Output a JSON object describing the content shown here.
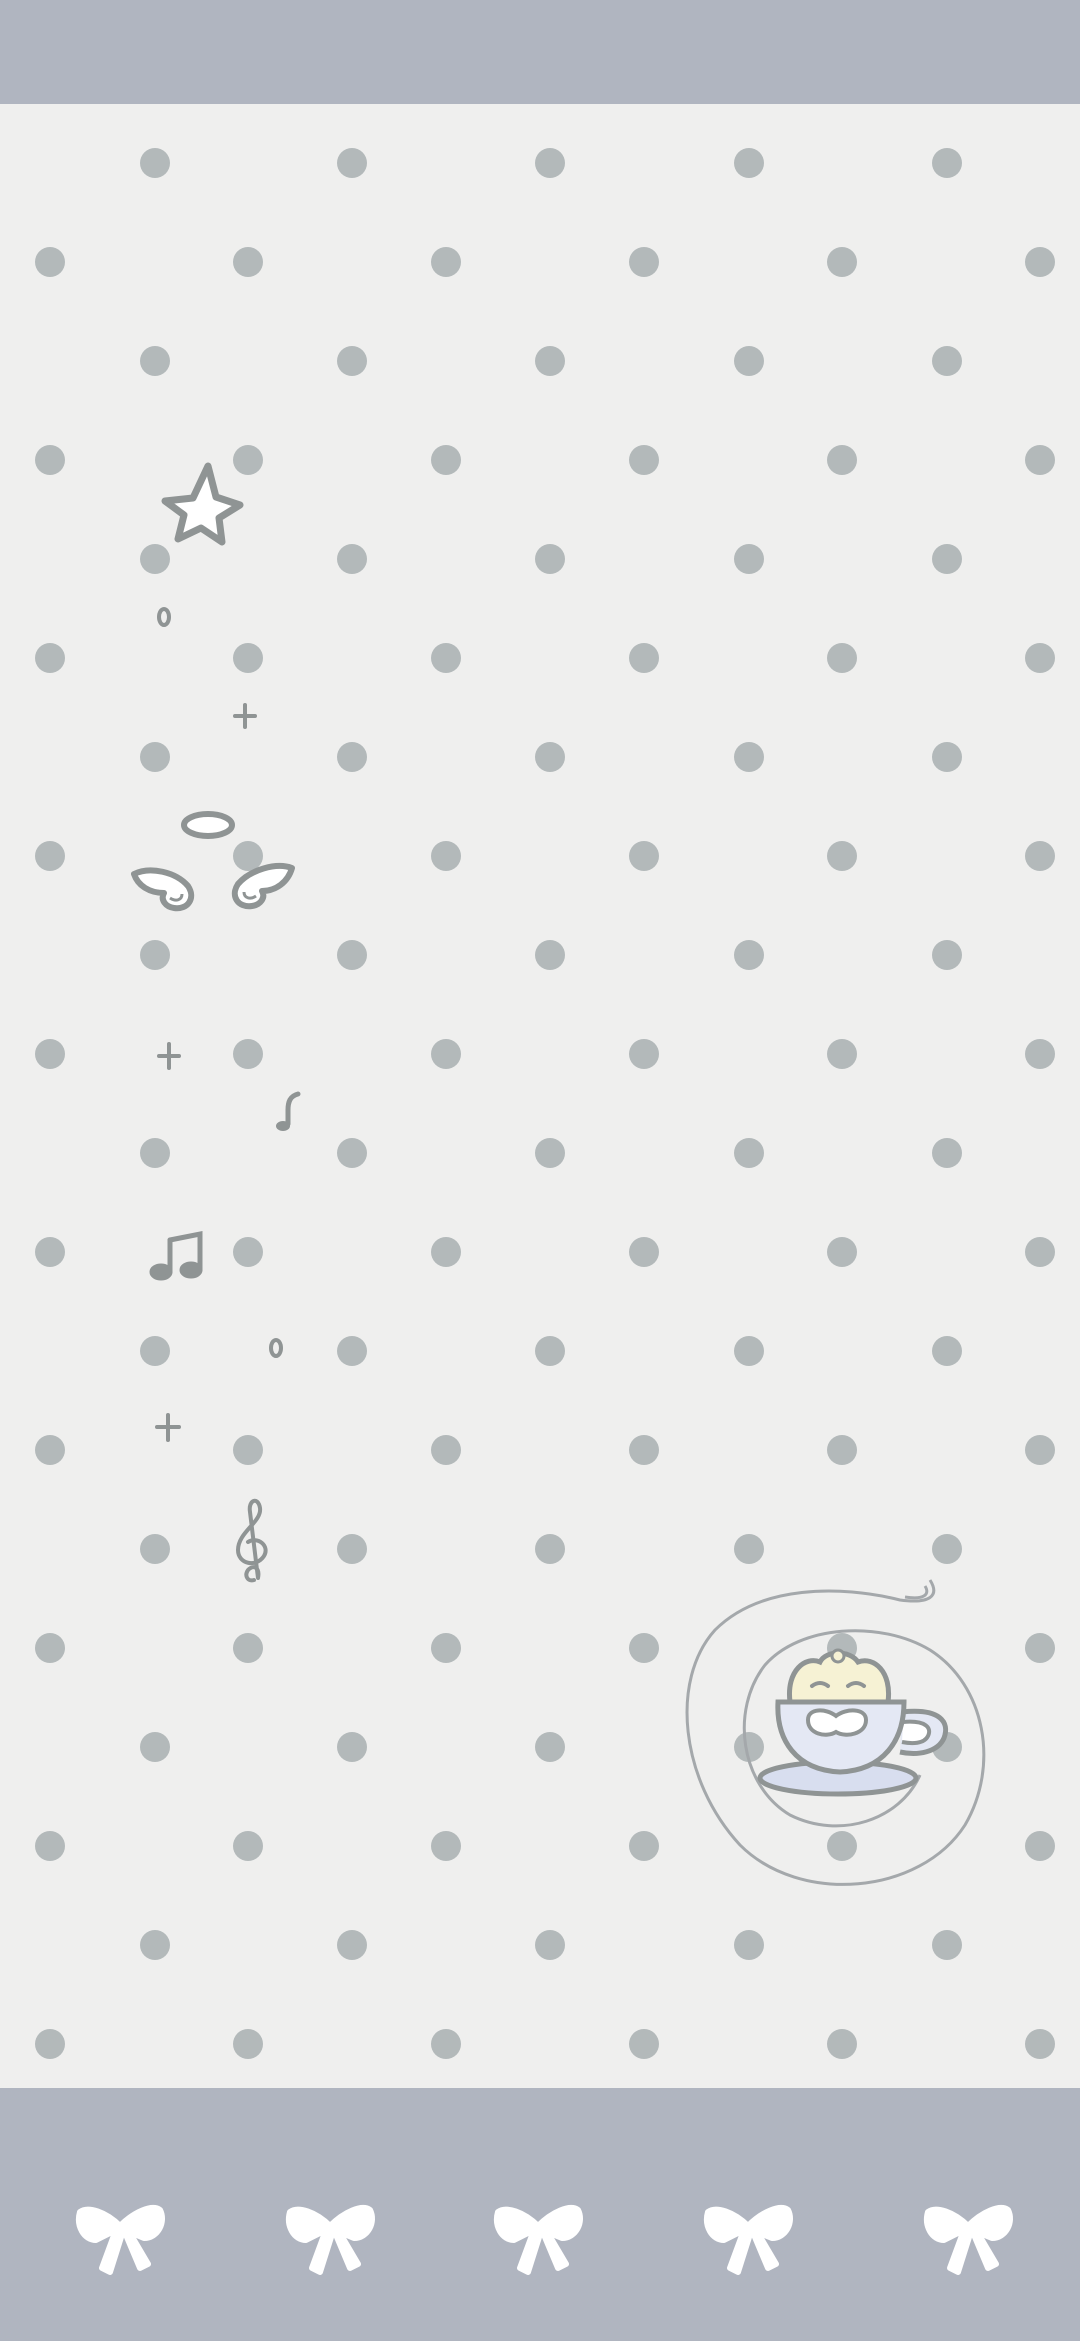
{
  "wallpaper": {
    "colors": {
      "band": "#b0b5c0",
      "paper": "#efefee",
      "dot": "#b3b9ba",
      "doodle_stroke": "#8f9494",
      "star_fill": "#ffffff",
      "cup_fill": "#e4e8f4",
      "cup_saucer_fill": "#d8deef",
      "creature_fill": "#f6f2d4",
      "bow_fill": "#ffffff",
      "swirl_stroke": "#a4a8ab"
    },
    "icons": [
      "star-icon",
      "halo-icon",
      "wing-left-icon",
      "wing-right-icon",
      "sparkle-icon",
      "eighth-note-icon",
      "beamed-notes-icon",
      "treble-clef-icon",
      "teacup-creature-icon",
      "swirl-icon",
      "bow-icon"
    ],
    "bow_count": 5
  }
}
